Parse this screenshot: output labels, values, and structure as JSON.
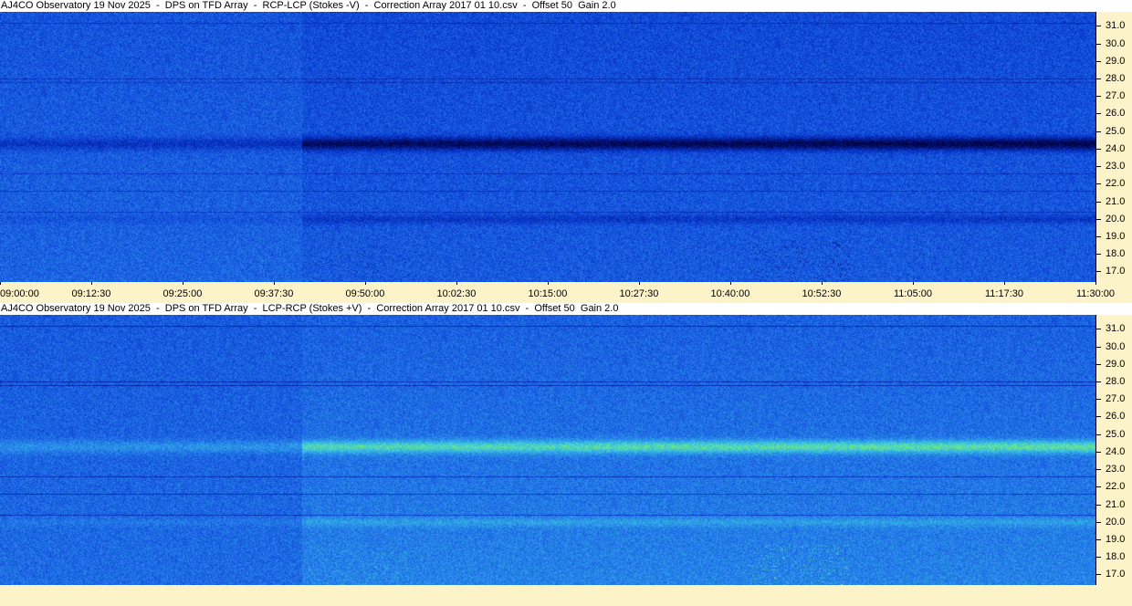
{
  "panels": [
    {
      "id": "top",
      "title": "AJ4CO Observatory 19 Nov 2025  -  DPS on TFD Array  -  RCP-LCP (Stokes -V)  -  Correction Array 2017 01 10.csv  -  Offset 50  Gain 2.0",
      "polarity": "minus-v",
      "show_time_axis": true
    },
    {
      "id": "bottom",
      "title": "AJ4CO Observatory 19 Nov 2025  -  DPS on TFD Array  -  LCP-RCP (Stokes +V)  -  Correction Array 2017 01 10.csv  -  Offset 50  Gain 2.0",
      "polarity": "plus-v",
      "show_time_axis": false
    }
  ],
  "frequency_axis": {
    "unit": "MHz",
    "range": [
      16.4,
      31.8
    ],
    "ticks": [
      "31.0",
      "30.0",
      "29.0",
      "28.0",
      "27.0",
      "26.0",
      "25.0",
      "24.0",
      "23.0",
      "22.0",
      "21.0",
      "20.0",
      "19.0",
      "18.0",
      "17.0"
    ]
  },
  "time_axis": {
    "start": "09:00:00",
    "end": "11:30:00",
    "ticks": [
      "09:00:00",
      "09:12:30",
      "09:25:00",
      "09:37:30",
      "09:50:00",
      "10:02:30",
      "10:15:00",
      "10:27:30",
      "10:40:00",
      "10:52:30",
      "11:05:00",
      "11:17:30",
      "11:30:00"
    ]
  },
  "colors": {
    "background": "#fdf3c9",
    "title_background": "#ffffff",
    "colormap": [
      "#00003a",
      "#001a8c",
      "#0a3ad0",
      "#1f6be6",
      "#2fa0e8",
      "#3fd0d8",
      "#8ef04a",
      "#d8f020"
    ]
  }
}
